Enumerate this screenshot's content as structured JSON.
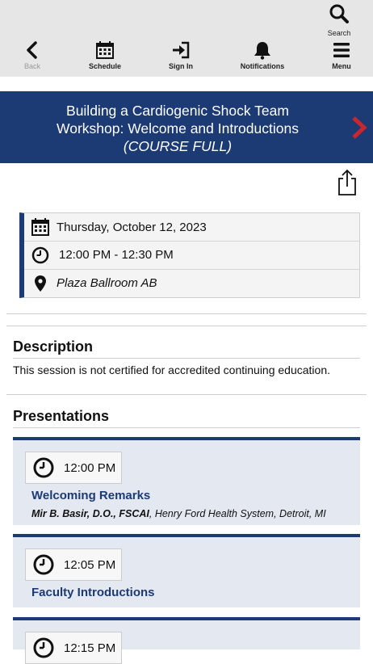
{
  "toolbar": {
    "search_label": "Search",
    "nav": [
      {
        "label": "Back",
        "icon": "chevron-left-icon"
      },
      {
        "label": "Schedule",
        "icon": "calendar-icon"
      },
      {
        "label": "Sign In",
        "icon": "sign-in-icon"
      },
      {
        "label": "Notifications",
        "icon": "bell-icon"
      },
      {
        "label": "Menu",
        "icon": "hamburger-menu-icon"
      }
    ]
  },
  "session": {
    "title_line1": "Building a Cardiogenic Shock Team",
    "title_line2": "Workshop: Welcome and Introductions",
    "status": "(COURSE FULL)",
    "date": "Thursday, October 12, 2023",
    "time": "12:00 PM - 12:30 PM",
    "location": "Plaza Ballroom AB"
  },
  "description": {
    "heading": "Description",
    "text": "This session is not certified for accredited continuing education."
  },
  "presentations": {
    "heading": "Presentations",
    "items": [
      {
        "time": "12:00 PM",
        "title": "Welcoming Remarks",
        "speaker": "Mir B. Basir, D.O., FSCAI",
        "affiliation": ", Henry Ford Health System, Detroit, MI"
      },
      {
        "time": "12:05 PM",
        "title": "Faculty Introductions",
        "speaker": "",
        "affiliation": ""
      },
      {
        "time": "12:15 PM",
        "title": "",
        "speaker": "",
        "affiliation": ""
      }
    ]
  },
  "colors": {
    "brand": "#1c3a73",
    "accent_arrow": "#c8282d",
    "card_bg": "#e3e8f1"
  }
}
